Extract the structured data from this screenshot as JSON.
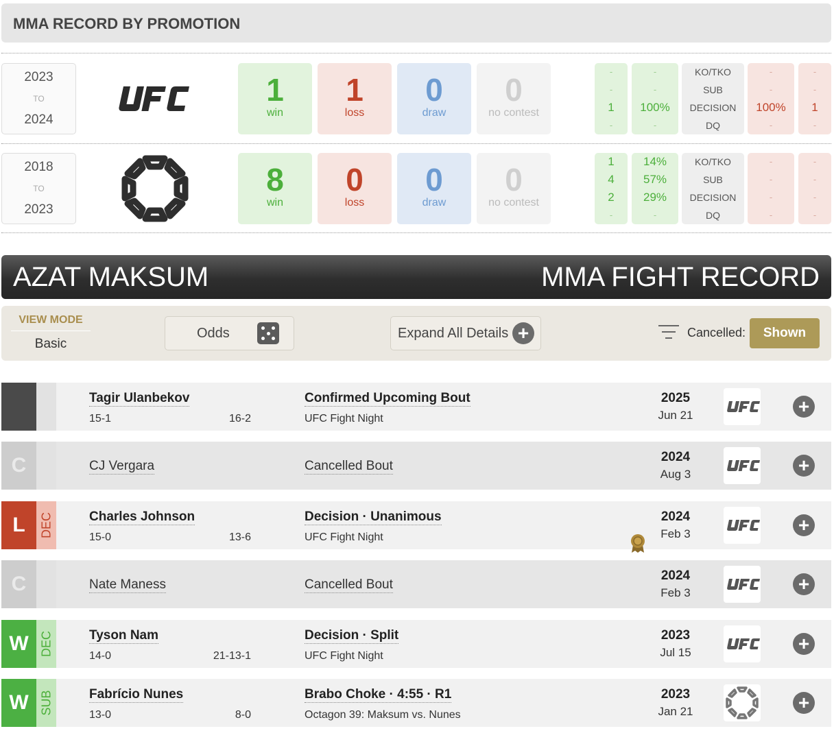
{
  "promotion_section": {
    "title": "MMA RECORD BY PROMOTION",
    "rows": [
      {
        "year_start": "2023",
        "to": "TO",
        "year_end": "2024",
        "logo": "ufc-logo",
        "win": "1",
        "win_label": "win",
        "loss": "1",
        "loss_label": "loss",
        "draw": "0",
        "draw_label": "draw",
        "nc": "0",
        "nc_label": "no contest",
        "win_counts": [
          "-",
          "-",
          "1",
          "-"
        ],
        "win_pcts": [
          "-",
          "-",
          "100%",
          "-"
        ],
        "methods": [
          "KO/TKO",
          "SUB",
          "DECISION",
          "DQ"
        ],
        "loss_pcts": [
          "-",
          "-",
          "100%",
          "-"
        ],
        "loss_counts": [
          "-",
          "-",
          "1",
          "-"
        ]
      },
      {
        "year_start": "2018",
        "to": "TO",
        "year_end": "2023",
        "logo": "octagon-league-logo",
        "win": "8",
        "win_label": "win",
        "loss": "0",
        "loss_label": "loss",
        "draw": "0",
        "draw_label": "draw",
        "nc": "0",
        "nc_label": "no contest",
        "win_counts": [
          "1",
          "4",
          "2",
          "-"
        ],
        "win_pcts": [
          "14%",
          "57%",
          "29%",
          "-"
        ],
        "methods": [
          "KO/TKO",
          "SUB",
          "DECISION",
          "DQ"
        ],
        "loss_pcts": [
          "-",
          "-",
          "-",
          "-"
        ],
        "loss_counts": [
          "-",
          "-",
          "-",
          "-"
        ]
      }
    ]
  },
  "title_bar": {
    "fighter": "AZAT MAKSUM",
    "heading": "MMA FIGHT RECORD"
  },
  "view_bar": {
    "view_mode_label": "VIEW MODE",
    "view_mode_value": "Basic",
    "odds_label": "Odds",
    "expand_label": "Expand All Details",
    "cancelled_label": "Cancelled:",
    "shown_label": "Shown"
  },
  "colors": {
    "win": "#4cb043",
    "loss": "#c0442a",
    "draw": "#6d9bd1",
    "accent": "#ad9a58"
  },
  "fights": [
    {
      "result": "",
      "method": "",
      "opponent": "Tagir Ulanbekov",
      "opp_record": "15-1",
      "fighter_record": "16-2",
      "detail": "Confirmed Upcoming Bout",
      "event": "UFC Fight Night",
      "year": "2025",
      "date": "Jun 21",
      "promotion": "ufc-logo"
    },
    {
      "result": "C",
      "method": "",
      "opponent": "CJ Vergara",
      "opp_record": "",
      "fighter_record": "",
      "detail": "Cancelled Bout",
      "event": "",
      "year": "2024",
      "date": "Aug 3",
      "promotion": "ufc-logo"
    },
    {
      "result": "L",
      "method": "DEC",
      "opponent": "Charles Johnson",
      "opp_record": "15-0",
      "fighter_record": "13-6",
      "detail": "Decision · Unanimous",
      "event": "UFC Fight Night",
      "year": "2024",
      "date": "Feb 3",
      "promotion": "ufc-logo",
      "bonus": "medal-icon"
    },
    {
      "result": "C",
      "method": "",
      "opponent": "Nate Maness",
      "opp_record": "",
      "fighter_record": "",
      "detail": "Cancelled Bout",
      "event": "",
      "year": "2024",
      "date": "Feb 3",
      "promotion": "ufc-logo"
    },
    {
      "result": "W",
      "method": "DEC",
      "opponent": "Tyson Nam",
      "opp_record": "14-0",
      "fighter_record": "21-13-1",
      "detail": "Decision · Split",
      "event": "UFC Fight Night",
      "year": "2023",
      "date": "Jul 15",
      "promotion": "ufc-logo"
    },
    {
      "result": "W",
      "method": "SUB",
      "opponent": "Fabrício Nunes",
      "opp_record": "13-0",
      "fighter_record": "8-0",
      "detail": "Brabo Choke · 4:55 · R1",
      "event": "Octagon 39: Maksum vs. Nunes",
      "year": "2023",
      "date": "Jan 21",
      "promotion": "octagon-league-logo"
    }
  ]
}
